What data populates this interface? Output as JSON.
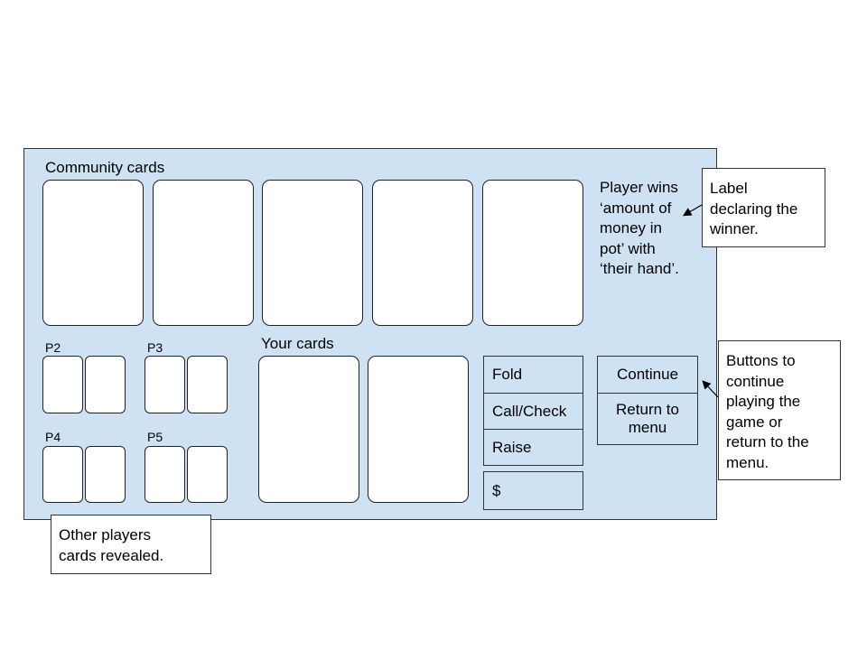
{
  "table": {
    "community_label": "Community cards",
    "your_cards_label": "Your cards",
    "players": [
      {
        "label": "P2"
      },
      {
        "label": "P3"
      },
      {
        "label": "P4"
      },
      {
        "label": "P5"
      }
    ],
    "winner_text": "Player wins\n‘amount of\nmoney in\npot’ with\n‘their hand’.",
    "actions": {
      "fold": "Fold",
      "call_check": "Call/Check",
      "raise": "Raise",
      "bet_currency": "$"
    },
    "menu": {
      "continue": "Continue",
      "return_to_menu": "Return to\nmenu"
    }
  },
  "annotations": {
    "winner_note": "Label\ndeclaring the\nwinner.",
    "buttons_note": "Buttons to\ncontinue\nplaying the\ngame or\nreturn to the\nmenu.",
    "others_note": "Other players\ncards revealed."
  },
  "colors": {
    "table_bg": "#cfe2f3",
    "card_bg": "#ffffff",
    "border": "#333333"
  }
}
